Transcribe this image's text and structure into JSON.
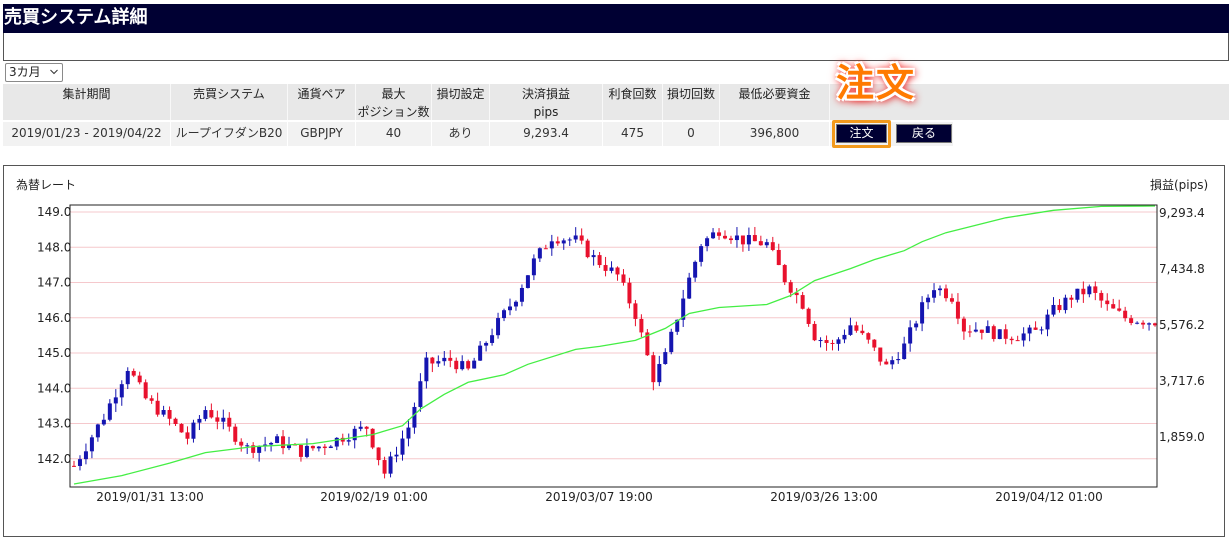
{
  "window": {
    "title": "売買システム詳細"
  },
  "period_select": {
    "value": "3カ月"
  },
  "order_callout": "注文",
  "summary": {
    "headers": [
      [
        "集計期間"
      ],
      [
        "売買システム"
      ],
      [
        "通貨ペア"
      ],
      [
        "最大",
        "ポジション数"
      ],
      [
        "損切設定"
      ],
      [
        "決済損益",
        "pips"
      ],
      [
        "利食回数"
      ],
      [
        "損切回数"
      ],
      [
        "最低必要資金"
      ]
    ],
    "values": [
      "2019/01/23 - 2019/04/22",
      "ループイフダンB20",
      "GBPJPY",
      "40",
      "あり",
      "9,293.4",
      "475",
      "0",
      "396,800"
    ],
    "buttons": {
      "order": "注文",
      "back": "戻る"
    }
  },
  "chart_data": {
    "type": "candlestick",
    "left_axis_label": "為替レート",
    "right_axis_label": "損益(pips)",
    "ylim_left": [
      141.2,
      149.2
    ],
    "yticks_left": [
      "149.0",
      "148.0",
      "147.0",
      "146.0",
      "145.0",
      "144.0",
      "143.0",
      "142.0"
    ],
    "ylim_right": [
      0,
      9293.4
    ],
    "yticks_right": [
      "9,293.4",
      "7,434.8",
      "5,576.2",
      "3,717.6",
      "1,859.0"
    ],
    "xticks": [
      "2019/01/31 13:00",
      "2019/02/19 01:00",
      "2019/03/07 19:00",
      "2019/03/26 13:00",
      "2019/04/12 01:00"
    ],
    "colors": {
      "up": "#1515b0",
      "down": "#e8112d",
      "pnl_line": "#44ee44",
      "grid": "#f5c8cc"
    },
    "close_path": [
      [
        0,
        141.8
      ],
      [
        5,
        143.2
      ],
      [
        9,
        144.6
      ],
      [
        12,
        143.7
      ],
      [
        16,
        143.1
      ],
      [
        19,
        142.6
      ],
      [
        22,
        143.4
      ],
      [
        25,
        143.0
      ],
      [
        29,
        142.3
      ],
      [
        34,
        142.5
      ],
      [
        38,
        142.2
      ],
      [
        42,
        142.4
      ],
      [
        46,
        142.7
      ],
      [
        49,
        142.9
      ],
      [
        52,
        141.6
      ],
      [
        56,
        142.9
      ],
      [
        59,
        144.7
      ],
      [
        63,
        144.8
      ],
      [
        66,
        144.5
      ],
      [
        70,
        145.6
      ],
      [
        74,
        146.6
      ],
      [
        77,
        147.6
      ],
      [
        80,
        148.3
      ],
      [
        84,
        148.2
      ],
      [
        87,
        147.7
      ],
      [
        91,
        147.2
      ],
      [
        94,
        146.1
      ],
      [
        97,
        144.3
      ],
      [
        99,
        144.9
      ],
      [
        102,
        146.6
      ],
      [
        105,
        148.1
      ],
      [
        108,
        148.5
      ],
      [
        112,
        148.2
      ],
      [
        116,
        148.1
      ],
      [
        119,
        147.1
      ],
      [
        122,
        146.4
      ],
      [
        124,
        145.5
      ],
      [
        127,
        145.2
      ],
      [
        130,
        145.8
      ],
      [
        133,
        145.3
      ],
      [
        136,
        144.6
      ],
      [
        139,
        145.2
      ],
      [
        142,
        146.3
      ],
      [
        144,
        146.9
      ],
      [
        147,
        146.6
      ],
      [
        149,
        145.7
      ],
      [
        152,
        145.7
      ],
      [
        155,
        145.5
      ],
      [
        158,
        145.5
      ],
      [
        161,
        145.6
      ],
      [
        164,
        146.2
      ],
      [
        167,
        146.6
      ],
      [
        170,
        146.8
      ],
      [
        173,
        146.3
      ],
      [
        176,
        146.0
      ],
      [
        180,
        145.9
      ],
      [
        181,
        145.9
      ]
    ],
    "pnl_path": [
      [
        0,
        0
      ],
      [
        8,
        280
      ],
      [
        16,
        700
      ],
      [
        22,
        1050
      ],
      [
        30,
        1250
      ],
      [
        40,
        1350
      ],
      [
        50,
        1650
      ],
      [
        55,
        1950
      ],
      [
        58,
        2500
      ],
      [
        62,
        3000
      ],
      [
        66,
        3400
      ],
      [
        72,
        3650
      ],
      [
        76,
        4000
      ],
      [
        84,
        4500
      ],
      [
        88,
        4600
      ],
      [
        94,
        4800
      ],
      [
        99,
        5200
      ],
      [
        103,
        5700
      ],
      [
        108,
        5900
      ],
      [
        112,
        5950
      ],
      [
        116,
        6000
      ],
      [
        120,
        6300
      ],
      [
        124,
        6800
      ],
      [
        130,
        7200
      ],
      [
        134,
        7500
      ],
      [
        139,
        7800
      ],
      [
        142,
        8100
      ],
      [
        146,
        8400
      ],
      [
        150,
        8600
      ],
      [
        156,
        8900
      ],
      [
        164,
        9150
      ],
      [
        172,
        9280
      ],
      [
        181,
        9293.4
      ]
    ]
  }
}
